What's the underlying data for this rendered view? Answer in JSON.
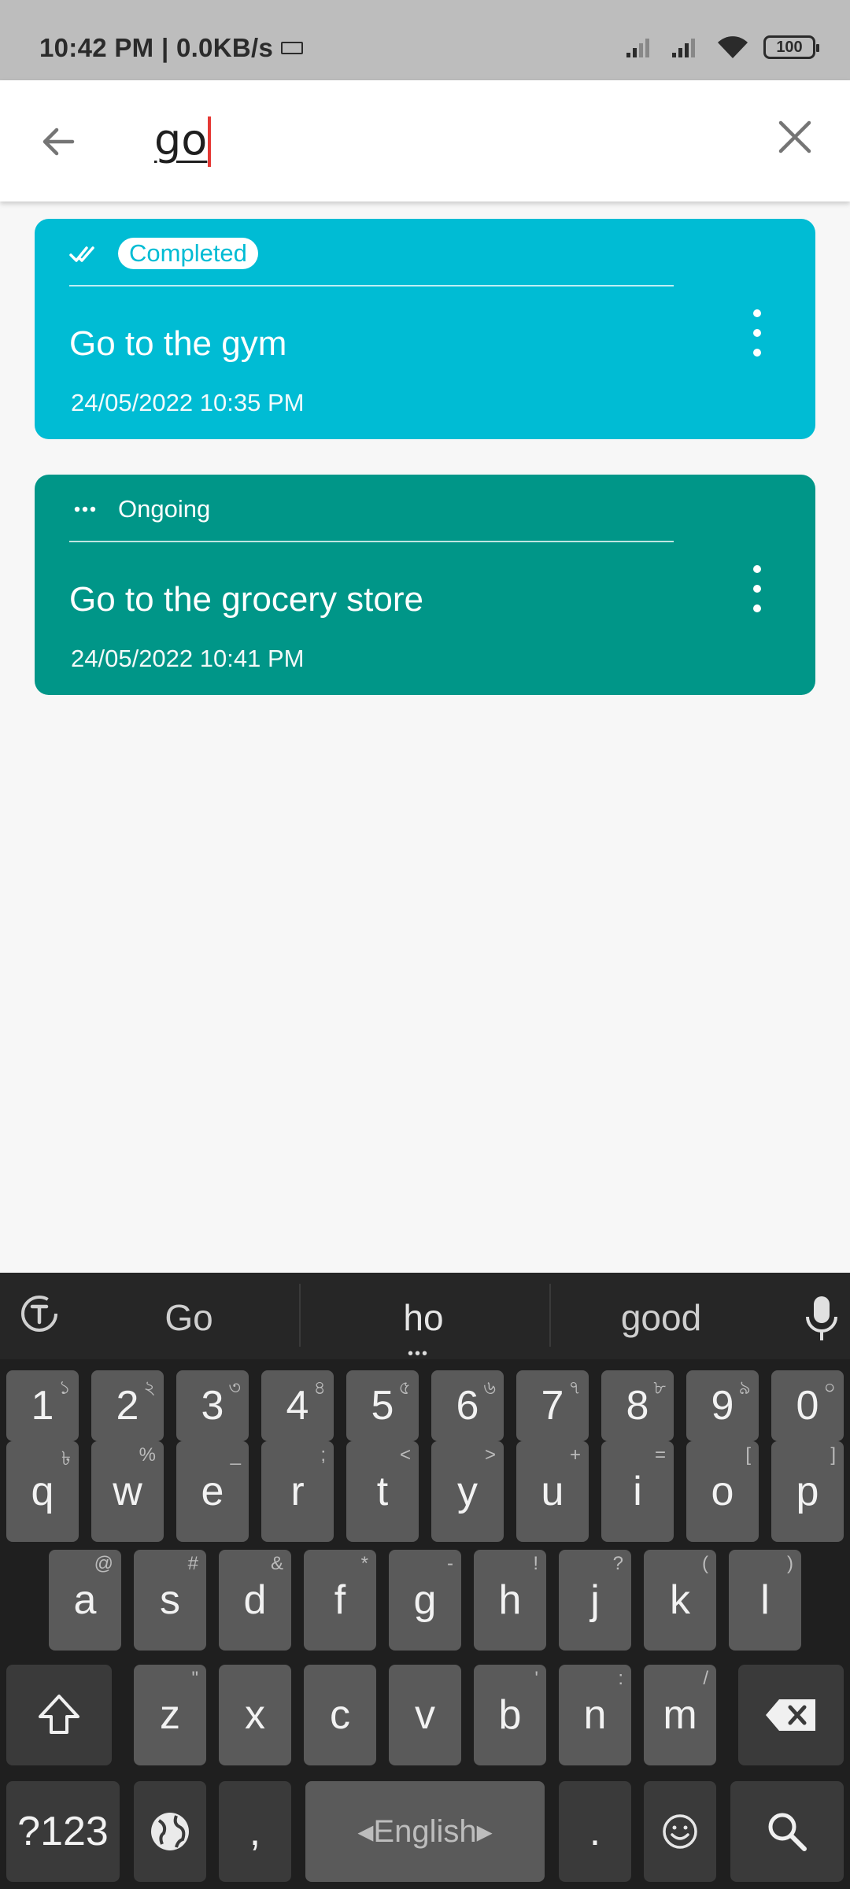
{
  "status_bar": {
    "time_speed": "10:42 PM | 0.0KB/s",
    "battery": "100"
  },
  "search": {
    "query": "go"
  },
  "cards": [
    {
      "status": "Completed",
      "title": "Go to the gym",
      "date": "24/05/2022 10:35 PM",
      "color": "#00bcd4"
    },
    {
      "status": "Ongoing",
      "title": "Go to the grocery store",
      "date": "24/05/2022 10:41 PM",
      "color": "#009688"
    }
  ],
  "keyboard": {
    "suggestions": [
      "Go",
      "ho",
      "good"
    ],
    "number_row": [
      {
        "k": "1",
        "a": "১"
      },
      {
        "k": "2",
        "a": "২"
      },
      {
        "k": "3",
        "a": "৩"
      },
      {
        "k": "4",
        "a": "৪"
      },
      {
        "k": "5",
        "a": "৫"
      },
      {
        "k": "6",
        "a": "৬"
      },
      {
        "k": "7",
        "a": "৭"
      },
      {
        "k": "8",
        "a": "৮"
      },
      {
        "k": "9",
        "a": "৯"
      },
      {
        "k": "0",
        "a": "০"
      }
    ],
    "row1": [
      {
        "k": "q",
        "a": "৳"
      },
      {
        "k": "w",
        "a": "%"
      },
      {
        "k": "e",
        "a": "_"
      },
      {
        "k": "r",
        "a": ";"
      },
      {
        "k": "t",
        "a": "<"
      },
      {
        "k": "y",
        "a": ">"
      },
      {
        "k": "u",
        "a": "+"
      },
      {
        "k": "i",
        "a": "="
      },
      {
        "k": "o",
        "a": "["
      },
      {
        "k": "p",
        "a": "]"
      }
    ],
    "row2": [
      {
        "k": "a",
        "a": "@"
      },
      {
        "k": "s",
        "a": "#"
      },
      {
        "k": "d",
        "a": "&"
      },
      {
        "k": "f",
        "a": "*"
      },
      {
        "k": "g",
        "a": "-"
      },
      {
        "k": "h",
        "a": "!"
      },
      {
        "k": "j",
        "a": "?"
      },
      {
        "k": "k",
        "a": "("
      },
      {
        "k": "l",
        "a": ")"
      }
    ],
    "row3": [
      {
        "k": "z",
        "a": "\""
      },
      {
        "k": "x",
        "a": ""
      },
      {
        "k": "c",
        "a": ""
      },
      {
        "k": "v",
        "a": ""
      },
      {
        "k": "b",
        "a": "'"
      },
      {
        "k": "n",
        "a": ":"
      },
      {
        "k": "m",
        "a": "/"
      }
    ],
    "symbols_label": "?123",
    "comma": ",",
    "space_label": "English",
    "period": "."
  }
}
